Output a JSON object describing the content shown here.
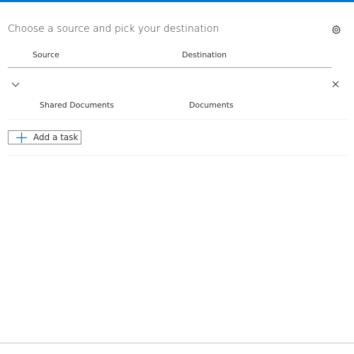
{
  "header": {
    "title": "Choose a source and pick your destination",
    "settings_icon": "gear-icon"
  },
  "columns": {
    "source": "Source",
    "destination": "Destination"
  },
  "tasks": [
    {
      "source": "Shared Documents",
      "destination": "Documents",
      "expand_icon": "chevron-down-icon",
      "remove_icon": "close-icon"
    }
  ],
  "actions": {
    "add_task_label": "Add a task",
    "add_icon": "plus-icon"
  },
  "colors": {
    "accent": "#0078d4",
    "text": "#323130",
    "divider": "#a19f9d"
  }
}
